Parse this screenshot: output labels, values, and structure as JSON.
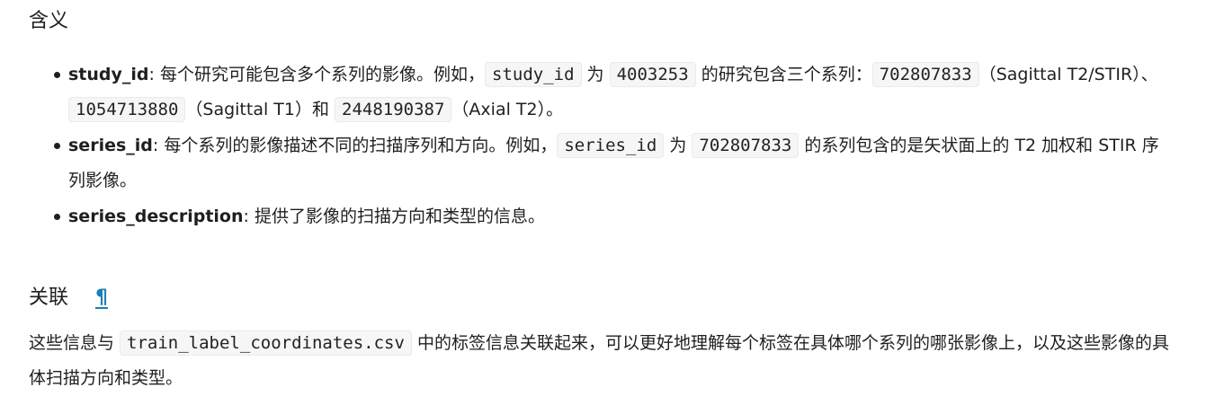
{
  "sections": {
    "meaning": {
      "heading": "含义",
      "items": [
        {
          "term": "study_id",
          "colon": ": ",
          "t1": "每个研究可能包含多个系列的影像。例如，",
          "c1": "study_id",
          "t2": " 为 ",
          "c2": "4003253",
          "t3": " 的研究包含三个系列：",
          "c3": "702807833",
          "t4": "（Sagittal T2/STIR）、",
          "c4": "1054713880",
          "t5": "（Sagittal T1）和 ",
          "c5": "2448190387",
          "t6": "（Axial T2）。"
        },
        {
          "term": "series_id",
          "colon": ": ",
          "t1": "每个系列的影像描述不同的扫描序列和方向。例如，",
          "c1": "series_id",
          "t2": " 为 ",
          "c2": "702807833",
          "t3": " 的系列包含的是矢状面上的 T2 加权和 STIR 序列影像。"
        },
        {
          "term": "series_description",
          "colon": ": ",
          "t1": "提供了影像的扫描方向和类型的信息。"
        }
      ]
    },
    "relation": {
      "heading": "关联",
      "anchor": "¶",
      "t1": "这些信息与 ",
      "c1": "train_label_coordinates.csv",
      "t2": " 中的标签信息关联起来，可以更好地理解每个标签在具体哪个系列的哪张影像上，以及这些影像的具体扫描方向和类型。"
    }
  }
}
